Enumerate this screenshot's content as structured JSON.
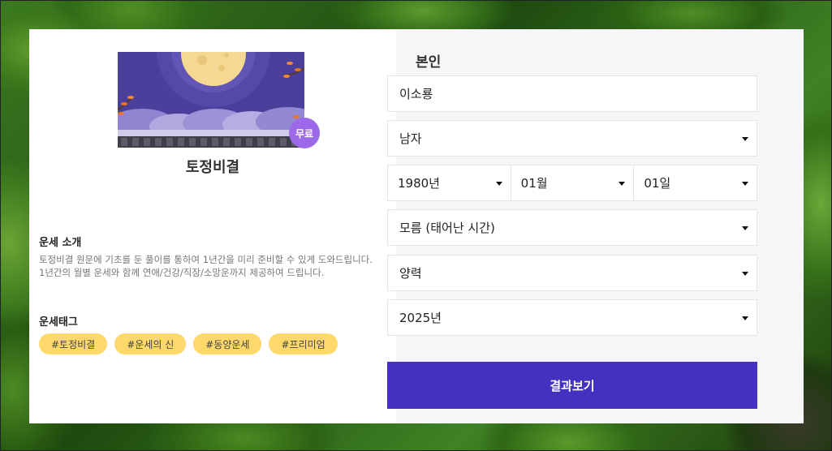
{
  "fortune": {
    "title": "토정비결",
    "badge": "무료",
    "intro_heading": "운세 소개",
    "intro_line1": "토정비결 원문에 기초를 둔 풀이를 통하여 1년간을 미리 준비할 수 있게 도와드립니다.",
    "intro_line2": "1년간의 월별 운세와 함께 연애/건강/직장/소망운까지 제공하여 드립니다.",
    "tags_heading": "운세태그",
    "tags": [
      "#토정비결",
      "#운세의 신",
      "#동양운세",
      "#프리미엄"
    ]
  },
  "form": {
    "section_label": "본인",
    "name_value": "이소룡",
    "gender_value": "남자",
    "birth_year": "1980년",
    "birth_month": "01월",
    "birth_day": "01일",
    "birth_time": "모름 (태어난 시간)",
    "calendar_type": "양력",
    "target_year": "2025년",
    "submit_label": "결과보기"
  },
  "colors": {
    "accent": "#4332c0",
    "tag_bg": "#fdd96b",
    "badge": "#9c6ae8"
  }
}
